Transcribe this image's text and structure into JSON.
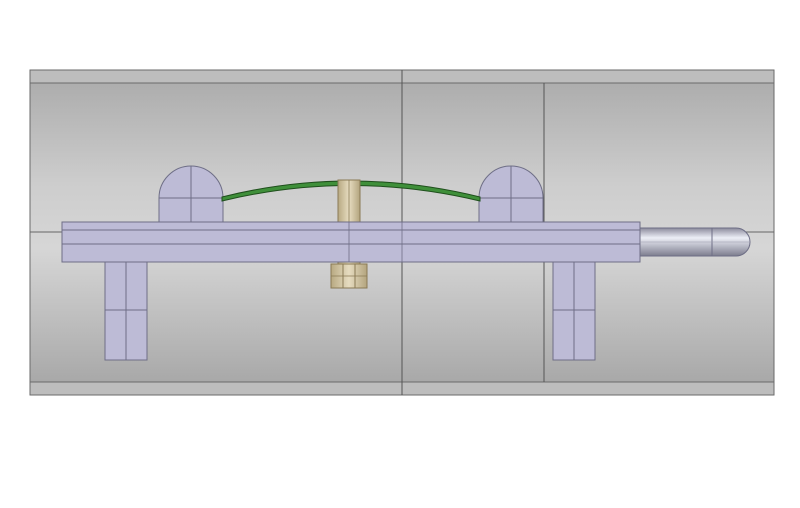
{
  "scene": {
    "kind": "cad-assembly-side-view",
    "colors": {
      "background": "#ffffff",
      "tube_light": "#d2d2d2",
      "tube_dark": "#a8a8a8",
      "tube_edge": "#555555",
      "part_fill": "#bdbbd6",
      "part_edge": "#6e6e86",
      "spring": "#3f8f3a",
      "spring_edge": "#1f4f1c",
      "bolt": "#d8ccaa",
      "bolt_edge": "#8a7a55",
      "rod_light": "#e6e6ef",
      "rod_dark": "#8b8b9c"
    },
    "icons": [
      "cylinder-housing-icon",
      "base-rail-icon",
      "rounded-post-icon",
      "leaf-spring-icon",
      "bolt-icon",
      "hex-nut-icon",
      "support-leg-icon",
      "rounded-rod-icon"
    ]
  }
}
